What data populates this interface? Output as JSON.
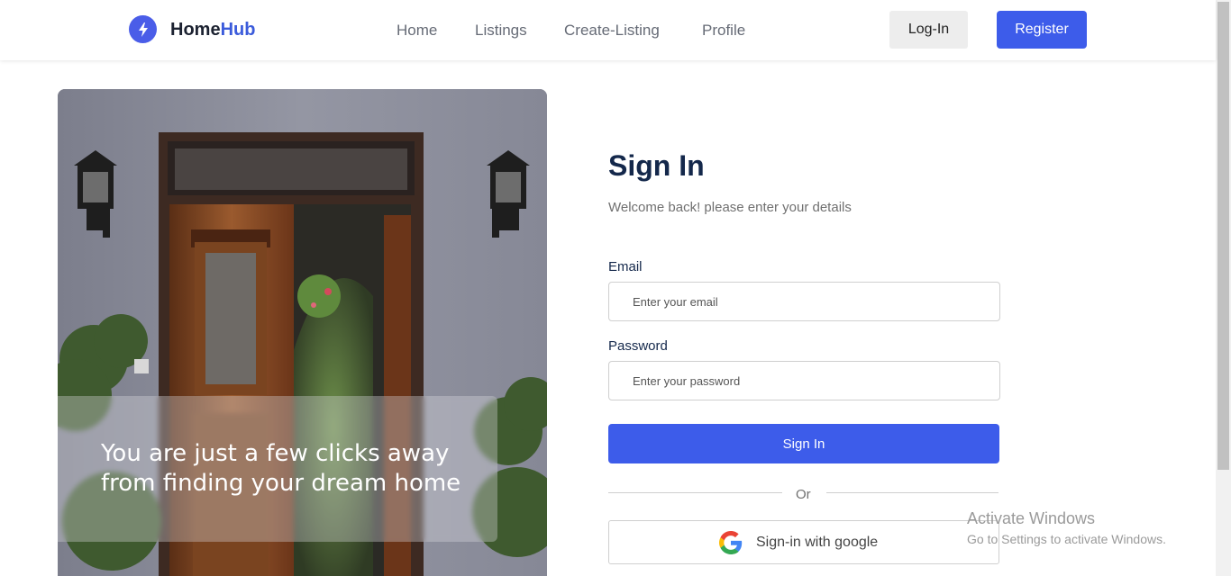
{
  "brand": {
    "name_part1": "Home",
    "name_part2": "Hub"
  },
  "nav": {
    "links": [
      "Home",
      "Listings",
      "Create-Listing",
      "Profile"
    ],
    "login_label": "Log-In",
    "register_label": "Register"
  },
  "hero": {
    "caption": "You are just a few clicks away from finding your dream home"
  },
  "form": {
    "title": "Sign In",
    "subtitle": "Welcome back! please enter your details",
    "email_label": "Email",
    "email_placeholder": "Enter your email",
    "email_value": "",
    "password_label": "Password",
    "password_placeholder": "Enter your password",
    "password_value": "",
    "submit_label": "Sign In",
    "divider_text": "Or",
    "google_label": "Sign-in with google"
  },
  "watermark": {
    "title": "Activate Windows",
    "subtitle": "Go to Settings to activate Windows."
  },
  "colors": {
    "primary": "#3d5cea",
    "heading": "#14284b",
    "muted": "#707070"
  }
}
